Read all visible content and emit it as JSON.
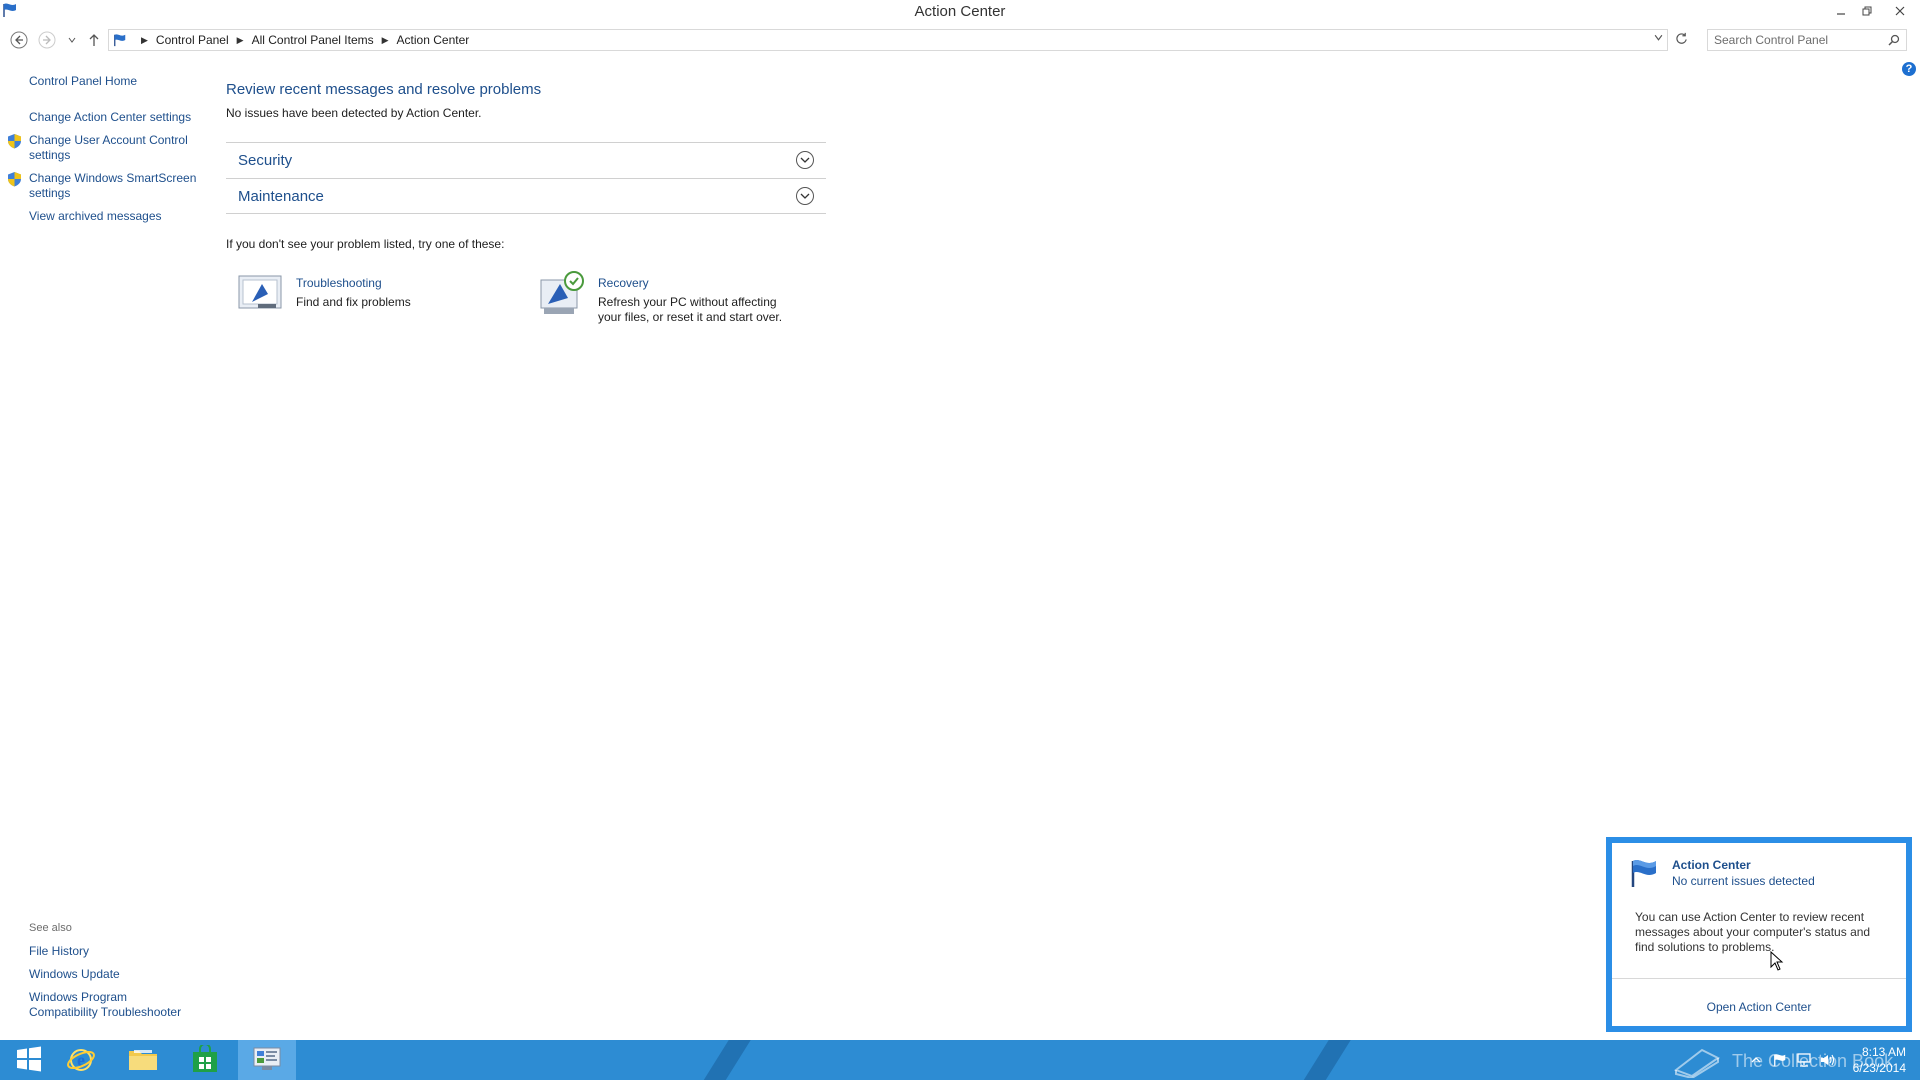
{
  "window": {
    "title": "Action Center"
  },
  "address": {
    "breadcrumbs": [
      "Control Panel",
      "All Control Panel Items",
      "Action Center"
    ],
    "search_placeholder": "Search Control Panel"
  },
  "left_pane": {
    "home": "Control Panel Home",
    "links": [
      "Change Action Center settings",
      "Change User Account Control settings",
      "Change Windows SmartScreen settings",
      "View archived messages"
    ]
  },
  "see_also": {
    "heading": "See also",
    "links": [
      "File History",
      "Windows Update",
      "Windows Program Compatibility Troubleshooter"
    ]
  },
  "main": {
    "heading": "Review recent messages and resolve problems",
    "subheading": "No issues have been detected by Action Center.",
    "sections": [
      "Security",
      "Maintenance"
    ],
    "try_hint": "If you don't see your problem listed, try one of these:",
    "tools": [
      {
        "title": "Troubleshooting",
        "description": "Find and fix problems"
      },
      {
        "title": "Recovery",
        "description": "Refresh your PC without affecting your files, or reset it and start over."
      }
    ]
  },
  "flyout": {
    "title": "Action Center",
    "subtitle": "No current issues detected",
    "text": "You can use Action Center to review recent messages about your computer's status and find solutions to problems.",
    "link": "Open Action Center"
  },
  "taskbar": {
    "watermark": "The Collection Book",
    "time": "8:13 AM",
    "date": "6/23/2014"
  },
  "colors": {
    "link": "#1e4f8c",
    "taskbar": "#2d8cd3",
    "flyout_border": "#2b8ee6"
  }
}
